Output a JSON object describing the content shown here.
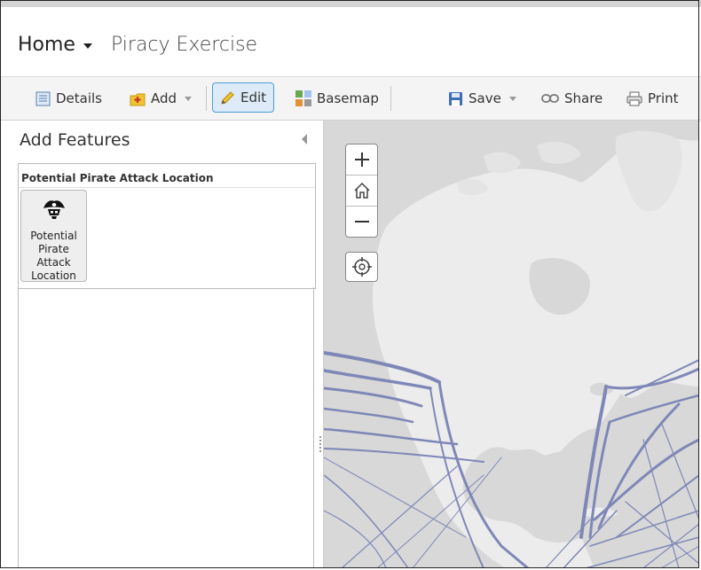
{
  "header": {
    "home_label": "Home",
    "map_title": "Piracy Exercise"
  },
  "toolbar": {
    "details_label": "Details",
    "add_label": "Add",
    "edit_label": "Edit",
    "basemap_label": "Basemap",
    "save_label": "Save",
    "share_label": "Share",
    "print_label": "Print"
  },
  "panel": {
    "title": "Add Features",
    "layer_name": "Potential Pirate Attack Location",
    "templates": [
      {
        "label": "Potential Pirate Attack Location",
        "icon": "pirate-hat-icon"
      }
    ]
  },
  "map": {
    "controls": {
      "zoom_in": "+",
      "zoom_out": "−"
    },
    "colors": {
      "land": "#ececec",
      "water": "#d8d8d8",
      "routes": "#7f87b7"
    }
  }
}
